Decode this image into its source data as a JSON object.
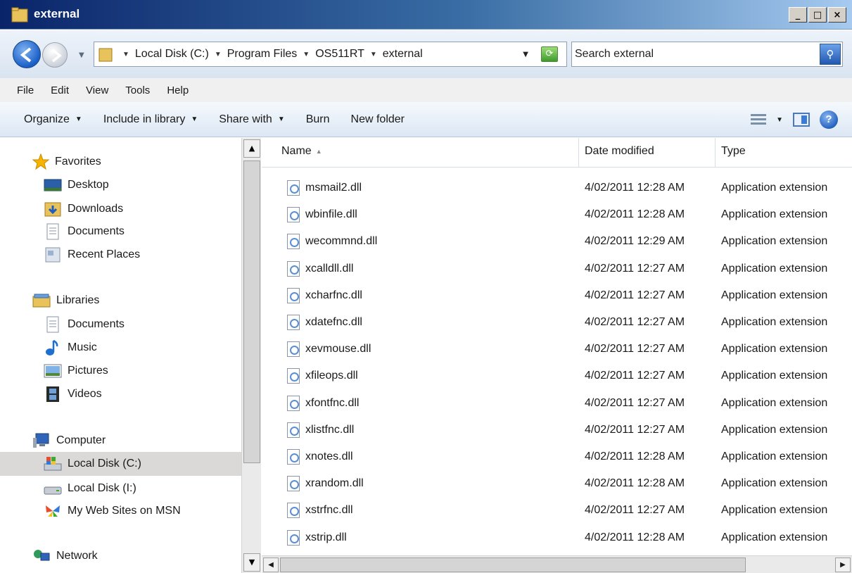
{
  "window": {
    "title": "external",
    "buttons": [
      "_",
      "□",
      "×"
    ]
  },
  "address": {
    "crumbs": [
      "Local Disk (C:)",
      "Program Files",
      "OS511RT",
      "external"
    ],
    "search_placeholder": "Search external"
  },
  "menu": [
    "File",
    "Edit",
    "View",
    "Tools",
    "Help"
  ],
  "commands": [
    {
      "label": "Organize",
      "dropdown": true
    },
    {
      "label": "Include in library",
      "dropdown": true
    },
    {
      "label": "Share with",
      "dropdown": true
    },
    {
      "label": "Burn",
      "dropdown": false
    },
    {
      "label": "New folder",
      "dropdown": false
    }
  ],
  "nav": {
    "favorites": {
      "label": "Favorites",
      "items": [
        "Desktop",
        "Downloads",
        "Documents",
        "Recent Places"
      ]
    },
    "libraries": {
      "label": "Libraries",
      "items": [
        "Documents",
        "Music",
        "Pictures",
        "Videos"
      ]
    },
    "computer": {
      "label": "Computer",
      "items": [
        "Local Disk (C:)",
        "Local Disk (I:)",
        "My Web Sites on MSN"
      ]
    },
    "network": {
      "label": "Network"
    }
  },
  "columns": {
    "name": "Name",
    "date": "Date modified",
    "type": "Type"
  },
  "files": [
    {
      "name": "msmail2.dll",
      "date": "4/02/2011 12:28 AM",
      "type": "Application extension"
    },
    {
      "name": "wbinfile.dll",
      "date": "4/02/2011 12:28 AM",
      "type": "Application extension"
    },
    {
      "name": "wecommnd.dll",
      "date": "4/02/2011 12:29 AM",
      "type": "Application extension"
    },
    {
      "name": "xcalldll.dll",
      "date": "4/02/2011 12:27 AM",
      "type": "Application extension"
    },
    {
      "name": "xcharfnc.dll",
      "date": "4/02/2011 12:27 AM",
      "type": "Application extension"
    },
    {
      "name": "xdatefnc.dll",
      "date": "4/02/2011 12:27 AM",
      "type": "Application extension"
    },
    {
      "name": "xevmouse.dll",
      "date": "4/02/2011 12:27 AM",
      "type": "Application extension"
    },
    {
      "name": "xfileops.dll",
      "date": "4/02/2011 12:27 AM",
      "type": "Application extension"
    },
    {
      "name": "xfontfnc.dll",
      "date": "4/02/2011 12:27 AM",
      "type": "Application extension"
    },
    {
      "name": "xlistfnc.dll",
      "date": "4/02/2011 12:27 AM",
      "type": "Application extension"
    },
    {
      "name": "xnotes.dll",
      "date": "4/02/2011 12:28 AM",
      "type": "Application extension"
    },
    {
      "name": "xrandom.dll",
      "date": "4/02/2011 12:28 AM",
      "type": "Application extension"
    },
    {
      "name": "xstrfnc.dll",
      "date": "4/02/2011 12:27 AM",
      "type": "Application extension"
    },
    {
      "name": "xstrip.dll",
      "date": "4/02/2011 12:28 AM",
      "type": "Application extension"
    }
  ],
  "icons": {
    "favorites": "star-icon",
    "desktop": "desktop-icon",
    "downloads": "downloads-folder-icon",
    "documents": "document-icon",
    "recent": "recent-places-icon",
    "libraries": "library-icon",
    "music": "music-note-icon",
    "pictures": "pictures-icon",
    "videos": "video-film-icon",
    "computer": "computer-icon",
    "drive": "drive-icon",
    "msn": "msn-butterfly-icon",
    "network": "network-icon"
  },
  "colors": {
    "title_start": "#0a246a",
    "title_end": "#a6caf0",
    "selected": "#dad9d7",
    "star": "#f5b400"
  }
}
